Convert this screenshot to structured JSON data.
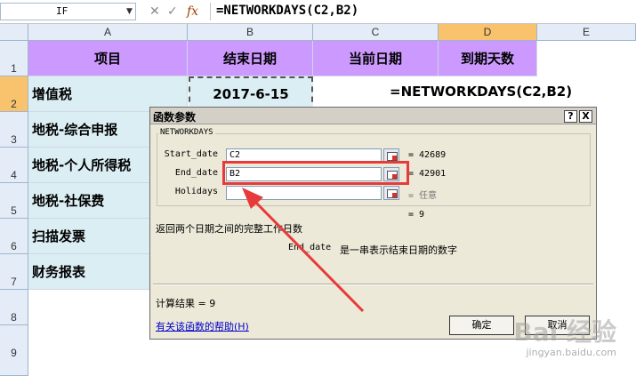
{
  "formula_bar": {
    "name_box": "IF",
    "formula": "=NETWORKDAYS(C2,B2)",
    "icons": [
      "cancel-icon",
      "enter-icon",
      "function-icon"
    ]
  },
  "columns": [
    "A",
    "B",
    "C",
    "D",
    "E"
  ],
  "rows": [
    "1",
    "2",
    "3",
    "4",
    "5",
    "6",
    "7",
    "8",
    "9"
  ],
  "sheet": {
    "headers": {
      "a1": "项目",
      "b1": "结束日期",
      "c1": "当前日期",
      "d1": "到期天数"
    },
    "a_col": [
      "增值税",
      "地税-综合申报",
      "地税-个人所得税",
      "地税-社保费",
      "扫描发票",
      "财务报表"
    ],
    "b2": "2017-6-15",
    "c2_formula": "=NETWORKDAYS(C2,B2)"
  },
  "dialog": {
    "title": "函数参数",
    "help_btn": "?",
    "close_btn": "X",
    "function_name": "NETWORKDAYS",
    "args": [
      {
        "label": "Start_date",
        "value": "C2",
        "result": "= 42689"
      },
      {
        "label": "End_date",
        "value": "B2",
        "result": "= 42901"
      },
      {
        "label": "Holidays",
        "value": "",
        "result": "= 任意"
      }
    ],
    "formula_result_line": "= 9",
    "description": "返回两个日期之间的完整工作日数",
    "arg_description_name": "End_date",
    "arg_description": "是一串表示结束日期的数字",
    "calc_result": "计算结果 =  9",
    "help_link": "有关该函数的帮助(H)",
    "ok": "确定",
    "cancel": "取消"
  },
  "watermark": {
    "logo": "Bai 经验",
    "url": "jingyan.baidu.com"
  },
  "colors": {
    "header_fill": "#cc99ff",
    "a_fill": "#dbeef4",
    "highlight": "#e83a3a"
  }
}
